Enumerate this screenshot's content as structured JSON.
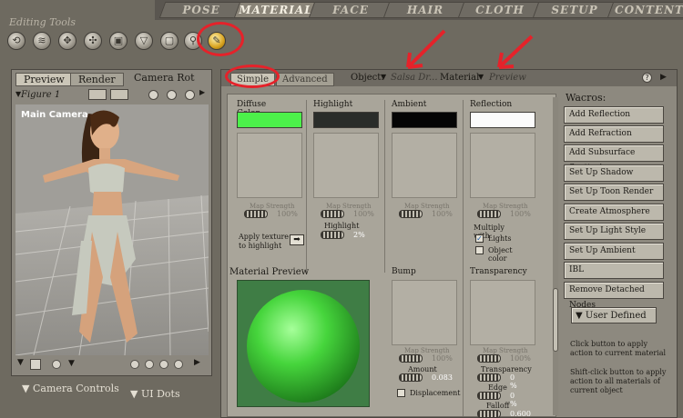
{
  "top_tabs": [
    "POSE",
    "MATERIAL",
    "FACE",
    "HAIR",
    "CLOTH",
    "SETUP",
    "CONTENT"
  ],
  "active_tab": "MATERIAL",
  "editing_tools": {
    "label": "Editing Tools",
    "tools": [
      "rotate-icon",
      "twist-icon",
      "translate-icon",
      "translate-in-out-icon",
      "scale-icon",
      "taper-icon",
      "chain-break-icon",
      "zoom-icon",
      "material-brush-icon"
    ]
  },
  "left_panel": {
    "tabs": [
      "Preview",
      "Render"
    ],
    "camera_label": "Camera Rot",
    "figure_label": "Figure 1",
    "viewport_camera": "Main Camera"
  },
  "bottom_left": {
    "camera_controls": "Camera Controls",
    "ui_dots": "UI Dots"
  },
  "material_panel": {
    "tabs": [
      "Simple",
      "Advanced"
    ],
    "active_tab": "Simple",
    "object_label": "Object:",
    "object_value": "Salsa Dr...",
    "material_label": "Material",
    "material_value": "Preview",
    "columns": {
      "diffuse": {
        "title": "Diffuse Color",
        "color": "#4cf04a",
        "map_strength": "Map Strength",
        "map_value": "100%"
      },
      "highlight": {
        "title": "Highlight",
        "color": "#2a2d2a",
        "map_strength": "Map Strength",
        "map_value": "100%",
        "size_label": "Highlight Size",
        "size_value": "2%"
      },
      "ambient": {
        "title": "Ambient",
        "color": "#050505",
        "map_strength": "Map Strength",
        "map_value": "100%"
      },
      "reflection": {
        "title": "Reflection",
        "color": "#fbfbfb",
        "map_strength": "Map Strength",
        "map_value": "100%",
        "multiply_label": "Multiply with:",
        "lights_label": "Lights",
        "object_color_label": "Object color"
      }
    },
    "apply_texture": "Apply texture to highlight",
    "preview_title": "Material Preview",
    "bump": {
      "title": "Bump",
      "map_strength": "Map Strength",
      "map_value": "100%",
      "amount_label": "Amount",
      "amount_value": "0.083",
      "displacement_label": "Displacement"
    },
    "transparency": {
      "title": "Transparency",
      "map_strength": "Map Strength",
      "map_value": "100%",
      "transparency_label": "Transparency",
      "transparency_value": "0 %",
      "edge_label": "Edge",
      "edge_value": "0 %",
      "falloff_label": "Falloff",
      "falloff_value": "0.600"
    }
  },
  "wacros": {
    "title": "Wacros:",
    "buttons": [
      "Add Reflection",
      "Add Refraction",
      "Add Subsurface Scattering",
      "Set Up Shadow Catcher",
      "Set Up Toon Render",
      "Create Atmosphere",
      "Set Up Light Style",
      "Set Up Ambient Occlusion",
      "IBL",
      "Remove Detached Nodes"
    ],
    "user_defined": "User Defined",
    "help1": "Click button to apply action to current material",
    "help2": "Shift-click button to apply action to all materials of current object"
  }
}
